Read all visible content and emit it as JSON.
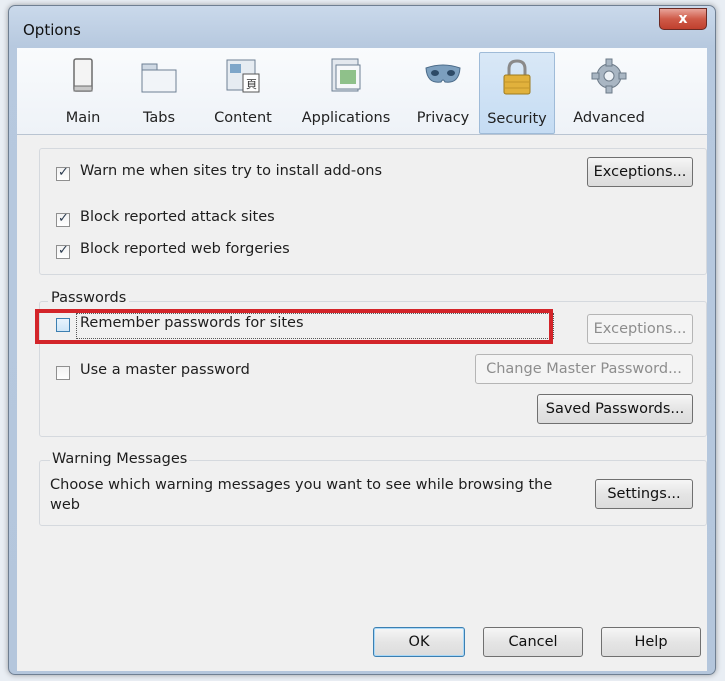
{
  "window": {
    "title": "Options",
    "close_glyph": "x"
  },
  "tabs": [
    {
      "label": "Main",
      "icon": "main-window-icon",
      "selected": false
    },
    {
      "label": "Tabs",
      "icon": "tabs-icon",
      "selected": false
    },
    {
      "label": "Content",
      "icon": "content-icon",
      "selected": false
    },
    {
      "label": "Applications",
      "icon": "applications-icon",
      "selected": false
    },
    {
      "label": "Privacy",
      "icon": "privacy-mask-icon",
      "selected": false
    },
    {
      "label": "Security",
      "icon": "padlock-icon",
      "selected": true
    },
    {
      "label": "Advanced",
      "icon": "gear-icon",
      "selected": false
    }
  ],
  "addons": {
    "warn_label": "Warn me when sites try to install add-ons",
    "warn_checked": true,
    "exceptions_label": "Exceptions...",
    "attack_label": "Block reported attack sites",
    "attack_checked": true,
    "forgeries_label": "Block reported web forgeries",
    "forgeries_checked": true
  },
  "passwords": {
    "legend": "Passwords",
    "remember_label": "Remember passwords for sites",
    "remember_checked": false,
    "exceptions_label": "Exceptions...",
    "master_label": "Use a master password",
    "master_checked": false,
    "change_master_label": "Change Master Password...",
    "saved_label": "Saved Passwords..."
  },
  "warnings": {
    "legend": "Warning Messages",
    "description": "Choose which warning messages you want to see while browsing the web",
    "settings_label": "Settings..."
  },
  "footer": {
    "ok_label": "OK",
    "cancel_label": "Cancel",
    "help_label": "Help"
  },
  "colors": {
    "highlight": "#d3252a",
    "selected_tab": "#c5dcf3"
  }
}
